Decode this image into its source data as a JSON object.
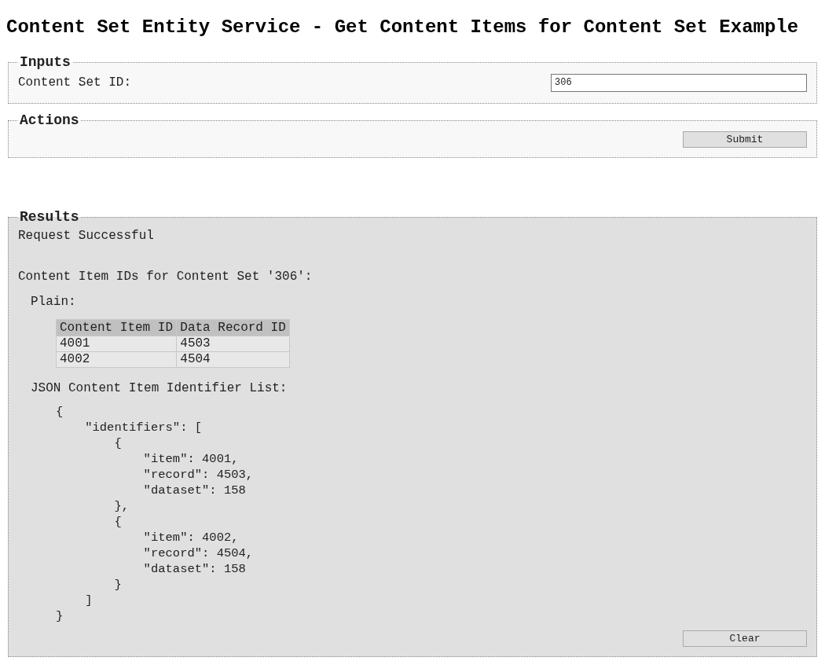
{
  "title": "Content Set Entity Service - Get Content Items for Content Set Example",
  "inputs": {
    "legend": "Inputs",
    "fields": [
      {
        "label": "Content Set ID:",
        "value": "306"
      }
    ]
  },
  "actions": {
    "legend": "Actions",
    "buttons": [
      "Submit"
    ]
  },
  "results": {
    "legend": "Results",
    "status": "Request Successful",
    "heading": "Content Item IDs for Content Set '306':",
    "plain_label": "Plain:",
    "table": {
      "columns": [
        "Content Item ID",
        "Data Record ID"
      ],
      "rows": [
        [
          "4001",
          "4503"
        ],
        [
          "4002",
          "4504"
        ]
      ]
    },
    "json_label": "JSON Content Item Identifier List:",
    "json_code": "{\n    \"identifiers\": [\n        {\n            \"item\": 4001,\n            \"record\": 4503,\n            \"dataset\": 158\n        },\n        {\n            \"item\": 4002,\n            \"record\": 4504,\n            \"dataset\": 158\n        }\n    ]\n}",
    "buttons": [
      "Clear"
    ]
  }
}
